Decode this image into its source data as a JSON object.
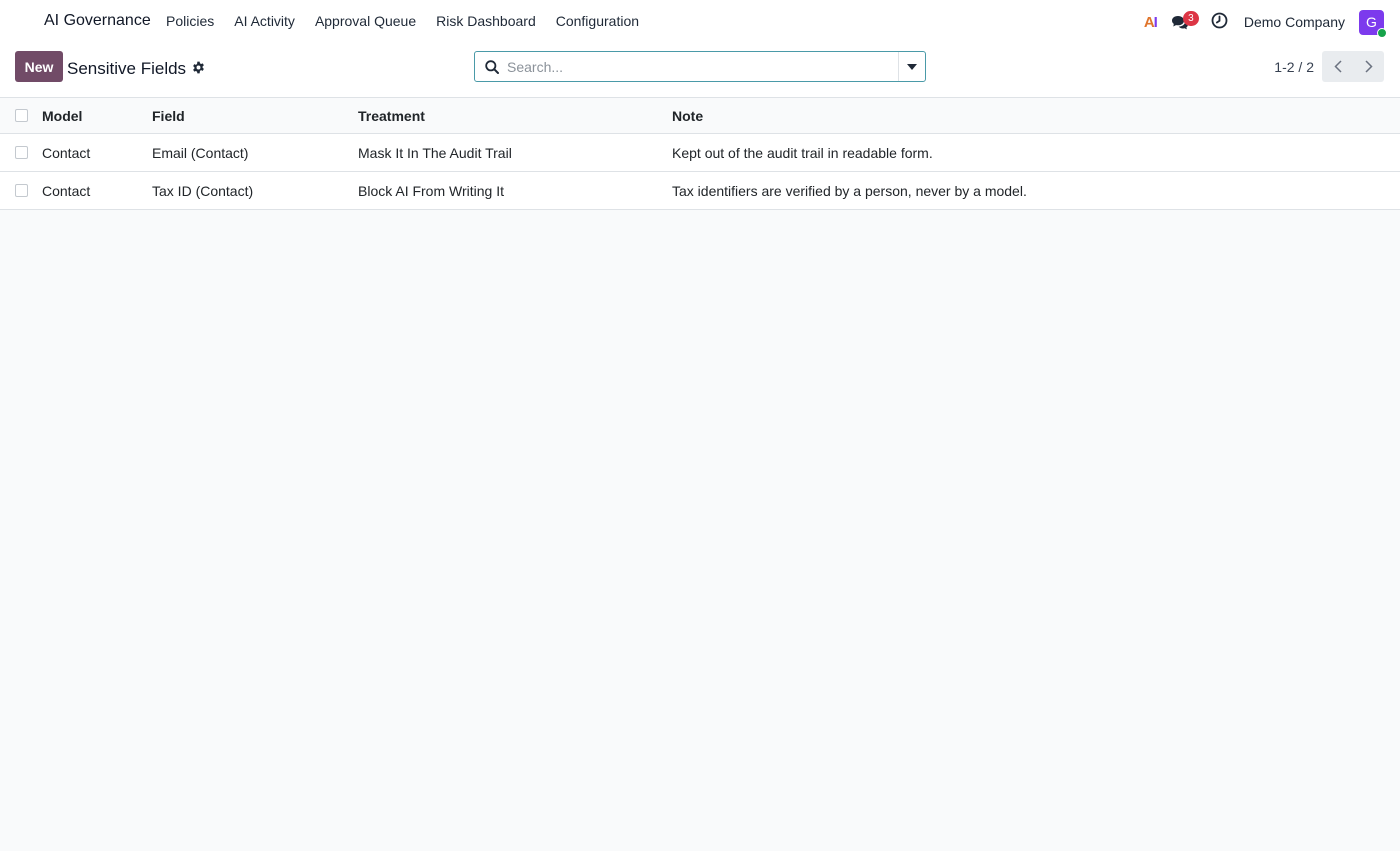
{
  "navbar": {
    "app_title": "AI Governance",
    "menu": [
      "Policies",
      "AI Activity",
      "Approval Queue",
      "Risk Dashboard",
      "Configuration"
    ],
    "ai_logo": {
      "a": "A",
      "i": "I"
    },
    "chat_badge": "3",
    "company": "Demo Company",
    "avatar_initial": "G",
    "colors": {
      "avatar": "#7c3aed",
      "badge": "#dc3545",
      "online": "#16a34a"
    }
  },
  "control_panel": {
    "new_label": "New",
    "title": "Sensitive Fields",
    "search_placeholder": "Search...",
    "pager": "1-2 / 2",
    "colors": {
      "primary": "#714b67"
    }
  },
  "table": {
    "columns": [
      "Model",
      "Field",
      "Treatment",
      "Note"
    ],
    "rows": [
      {
        "model": "Contact",
        "field": "Email (Contact)",
        "treatment": "Mask It In The Audit Trail",
        "note": "Kept out of the audit trail in readable form."
      },
      {
        "model": "Contact",
        "field": "Tax ID (Contact)",
        "treatment": "Block AI From Writing It",
        "note": "Tax identifiers are verified by a person, never by a model."
      }
    ]
  }
}
